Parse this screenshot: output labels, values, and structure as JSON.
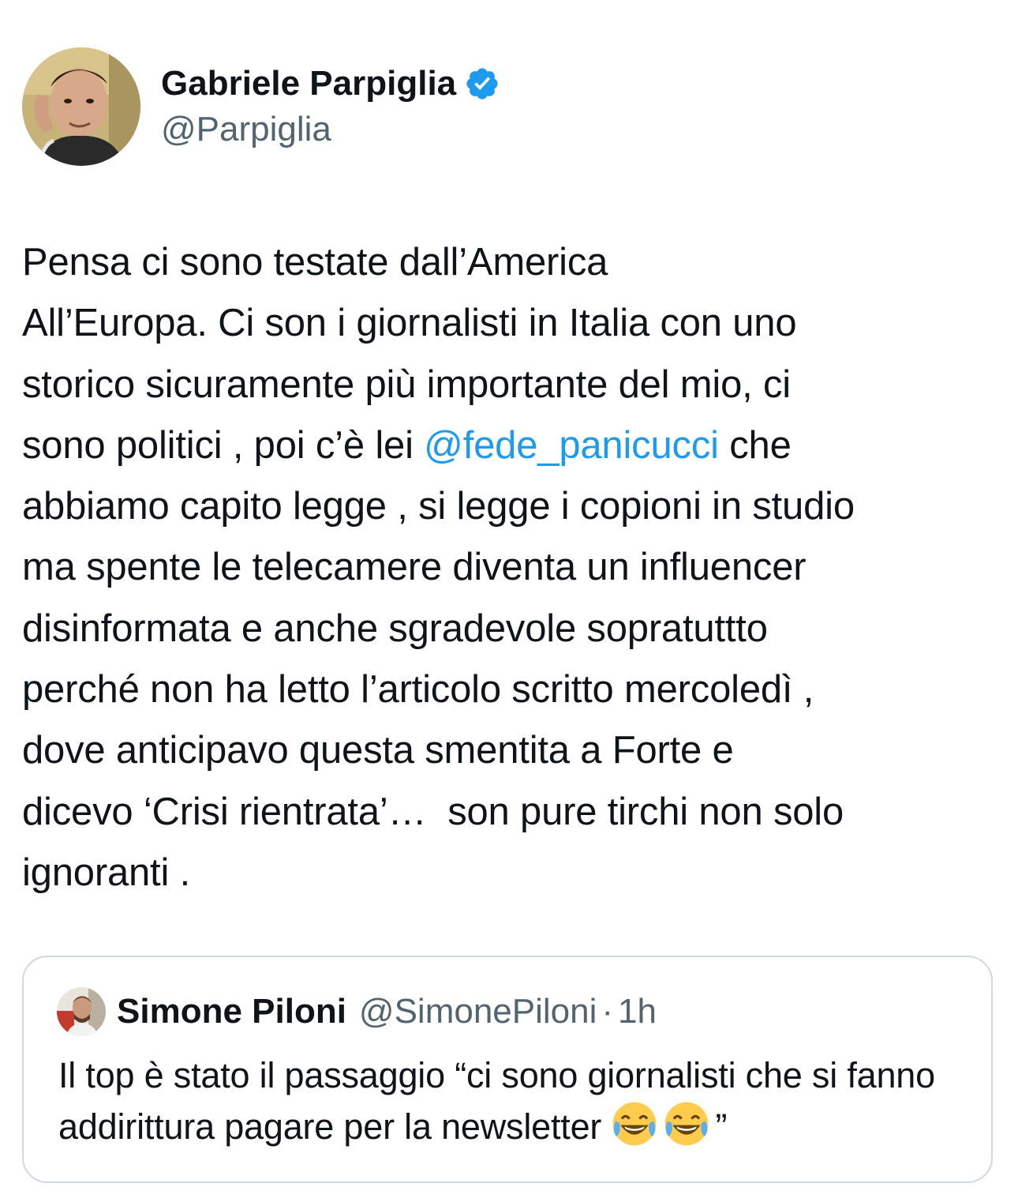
{
  "author": {
    "display_name": "Gabriele Parpiglia",
    "handle": "@Parpiglia",
    "verified_icon": "verified-badge-icon"
  },
  "tweet": {
    "text_before_mention": "Pensa ci sono testate dall’America\nAll’Europa. Ci son i giornalisti in Italia con uno\nstorico sicuramente più importante del mio, ci\nsono politici , poi c’è lei ",
    "mention": "@fede_panicucci",
    "text_after_mention": " che\nabbiamo capito legge , si legge i copioni in studio\nma spente le telecamere diventa un influencer\ndisinformata e anche sgradevole sopratuttto\nperché non ha letto l’articolo scritto mercoledì ,\ndove anticipavo questa smentita a Forte e\ndicevo ‘Crisi rientrata’…  son pure tirchi non solo\nignoranti ."
  },
  "quoted_tweet": {
    "display_name": "Simone Piloni",
    "handle": "@SimonePiloni",
    "separator": "·",
    "time": "1h",
    "text": "Il top è stato il passaggio “ci sono giornalisti che si fanno addirittura pagare per la newsletter ",
    "text_end": "”",
    "emojis": [
      "face-with-tears-of-joy-icon",
      "face-with-tears-of-joy-icon"
    ]
  },
  "colors": {
    "text": "#0f1419",
    "secondary": "#536471",
    "link": "#1d9bf0",
    "border": "#cfd9de"
  }
}
